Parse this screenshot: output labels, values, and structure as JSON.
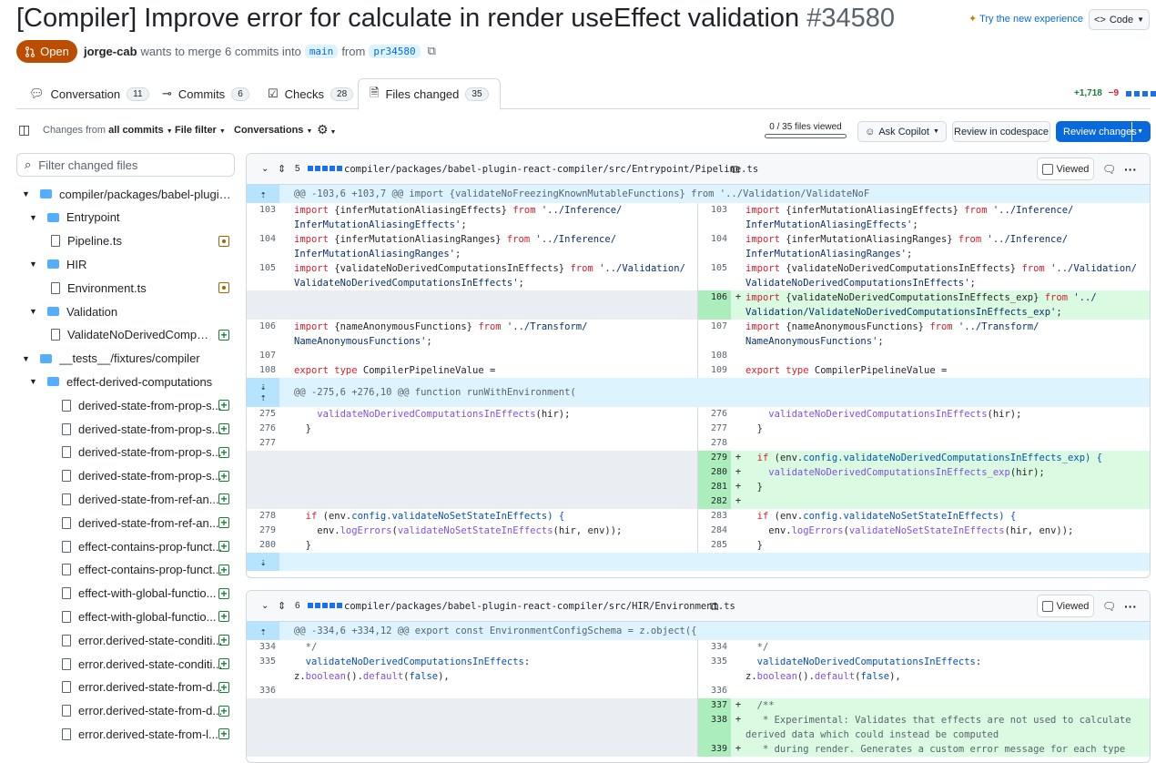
{
  "header": {
    "title": "[Compiler] Improve error for calculate in render useEffect validation",
    "number": "#34580",
    "try_new": "Try the new experience",
    "code_button": "Code"
  },
  "pr": {
    "state": "Open",
    "author": "jorge-cab",
    "merge_text": "wants to merge 6 commits into",
    "base": "main",
    "from_text": "from",
    "head": "pr34580"
  },
  "tabs": [
    {
      "label": "Conversation",
      "count": "11"
    },
    {
      "label": "Commits",
      "count": "6"
    },
    {
      "label": "Checks",
      "count": "28"
    },
    {
      "label": "Files changed",
      "count": "35"
    }
  ],
  "diffstat": {
    "additions": "+1,718",
    "deletions": "−9"
  },
  "toolbar": {
    "changes_prefix": "Changes from",
    "changes_value": "all commits",
    "file_filter": "File filter",
    "conversations": "Conversations",
    "files_viewed": "0 / 35 files viewed",
    "ask_copilot": "Ask Copilot",
    "review_codespace": "Review in codespace",
    "review_changes": "Review changes"
  },
  "sidebar": {
    "filter_placeholder": "Filter changed files",
    "tree": [
      {
        "label": "compiler/packages/babel-plugin-...",
        "type": "dir"
      },
      {
        "label": "Entrypoint",
        "type": "dir"
      },
      {
        "label": "Pipeline.ts",
        "type": "file",
        "status": "modified"
      },
      {
        "label": "HIR",
        "type": "dir"
      },
      {
        "label": "Environment.ts",
        "type": "file",
        "status": "modified"
      },
      {
        "label": "Validation",
        "type": "dir"
      },
      {
        "label": "ValidateNoDerivedComput...",
        "type": "file",
        "status": "added"
      },
      {
        "label": "__tests__/fixtures/compiler",
        "type": "dir"
      },
      {
        "label": "effect-derived-computations",
        "type": "dir"
      },
      {
        "label": "derived-state-from-prop-s...",
        "type": "file",
        "status": "added"
      },
      {
        "label": "derived-state-from-prop-s...",
        "type": "file",
        "status": "added"
      },
      {
        "label": "derived-state-from-prop-s...",
        "type": "file",
        "status": "added"
      },
      {
        "label": "derived-state-from-prop-s...",
        "type": "file",
        "status": "added"
      },
      {
        "label": "derived-state-from-ref-an...",
        "type": "file",
        "status": "added"
      },
      {
        "label": "derived-state-from-ref-an...",
        "type": "file",
        "status": "added"
      },
      {
        "label": "effect-contains-prop-funct...",
        "type": "file",
        "status": "added"
      },
      {
        "label": "effect-contains-prop-funct...",
        "type": "file",
        "status": "added"
      },
      {
        "label": "effect-with-global-functio...",
        "type": "file",
        "status": "added"
      },
      {
        "label": "effect-with-global-functio...",
        "type": "file",
        "status": "added"
      },
      {
        "label": "error.derived-state-conditi...",
        "type": "file",
        "status": "added"
      },
      {
        "label": "error.derived-state-conditi...",
        "type": "file",
        "status": "added"
      },
      {
        "label": "error.derived-state-from-d...",
        "type": "file",
        "status": "added"
      },
      {
        "label": "error.derived-state-from-d...",
        "type": "file",
        "status": "added"
      },
      {
        "label": "error.derived-state-from-l...",
        "type": "file",
        "status": "added"
      }
    ]
  },
  "files": [
    {
      "changes": "5",
      "path": "compiler/packages/babel-plugin-react-compiler/src/Entrypoint/Pipeline.ts",
      "viewed": "Viewed",
      "hunk1": "@@ -103,6 +103,7 @@ import {validateNoFreezingKnownMutableFunctions} from '../Validation/ValidateNoF",
      "hunk2": "@@ -275,6 +276,10 @@ function runWithEnvironment("
    },
    {
      "changes": "6",
      "path": "compiler/packages/babel-plugin-react-compiler/src/HIR/Environment.ts",
      "viewed": "Viewed",
      "hunk1": "@@ -334,6 +334,12 @@ export const EnvironmentConfigSchema = z.object({"
    }
  ],
  "lines": {
    "l103": "103",
    "r103": "103",
    "l104": "104",
    "r104": "104",
    "l105": "105",
    "r105": "105",
    "r106": "106",
    "l106": "106",
    "r107": "107",
    "l107": "107",
    "r108": "108",
    "l108": "108",
    "r109": "109",
    "l275": "275",
    "r276": "276",
    "l276": "276",
    "r277": "277",
    "l277": "277",
    "r278": "278",
    "r279": "279",
    "r280": "280",
    "r281": "281",
    "r282": "282",
    "l278": "278",
    "r283": "283",
    "l279": "279",
    "r284": "284",
    "l280": "280",
    "r285": "285",
    "l334": "334",
    "r334": "334",
    "l335": "335",
    "r335": "335",
    "l336": "336",
    "r336": "336",
    "r337": "337",
    "r338": "338",
    "r339": "339"
  },
  "code": {
    "a1": "import",
    "a2": " {inferMutationAliasingEffects} ",
    "a3": "from",
    "a4": " '../Inference/\nInferMutationAliasingEffects'",
    "b2": " {inferMutationAliasingRanges} ",
    "b4": " '../Inference/\nInferMutationAliasingRanges'",
    "c2": " {validateNoDerivedComputationsInEffects} ",
    "c4": " '../Validation/\nValidateNoDerivedComputationsInEffects'",
    "d2": " {validateNoDerivedComputationsInEffects_exp} ",
    "d4": " '../\nValidation/ValidateNoDerivedComputationsInEffects_exp'",
    "e2": " {nameAnonymousFunctions} ",
    "e4": " '../Transform/\nNameAnonymousFunctions'",
    "semi": ";",
    "f1": "export",
    "f2": "type",
    "f3": " CompilerPipelineValue =",
    "g1": "    validateNoDerivedComputationsInEffects",
    "g2": "(hir);",
    "h1": "  }",
    "i1": "  if",
    "i2": " (env.",
    "i3": "config",
    "i4": ".validateNoDerivedComputationsInEffects_exp) {",
    "j1": "    validateNoDerivedComputationsInEffects_exp",
    "j2": "(hir);",
    "k1": "  }",
    "m1": "  if",
    "m2": " (env.",
    "m3": "config",
    "m4": ".validateNoSetStateInEffects) {",
    "n1": "    env.",
    "n2": "logErrors",
    "n3": "(",
    "n4": "validateNoSetStateInEffects",
    "n5": "(hir, env));",
    "o1": "  }",
    "p1": "  */",
    "q1": "  validateNoDerivedComputationsInEffects",
    "q2": ":\nz.",
    "q3": "boolean",
    "q4": "().",
    "q5": "default",
    "q6": "(",
    "q7": "false",
    "q8": "),",
    "s1": "  /**",
    "t1": "   * Experimental: Validates that effects are not used to calculate\nderived data which could instead be computed",
    "u1": "   * during render. Generates a custom error message for each type"
  },
  "colors": {
    "accent": "#0969da",
    "open": "#bc4c00",
    "add": "#1a7f37",
    "del": "#d1242f"
  }
}
